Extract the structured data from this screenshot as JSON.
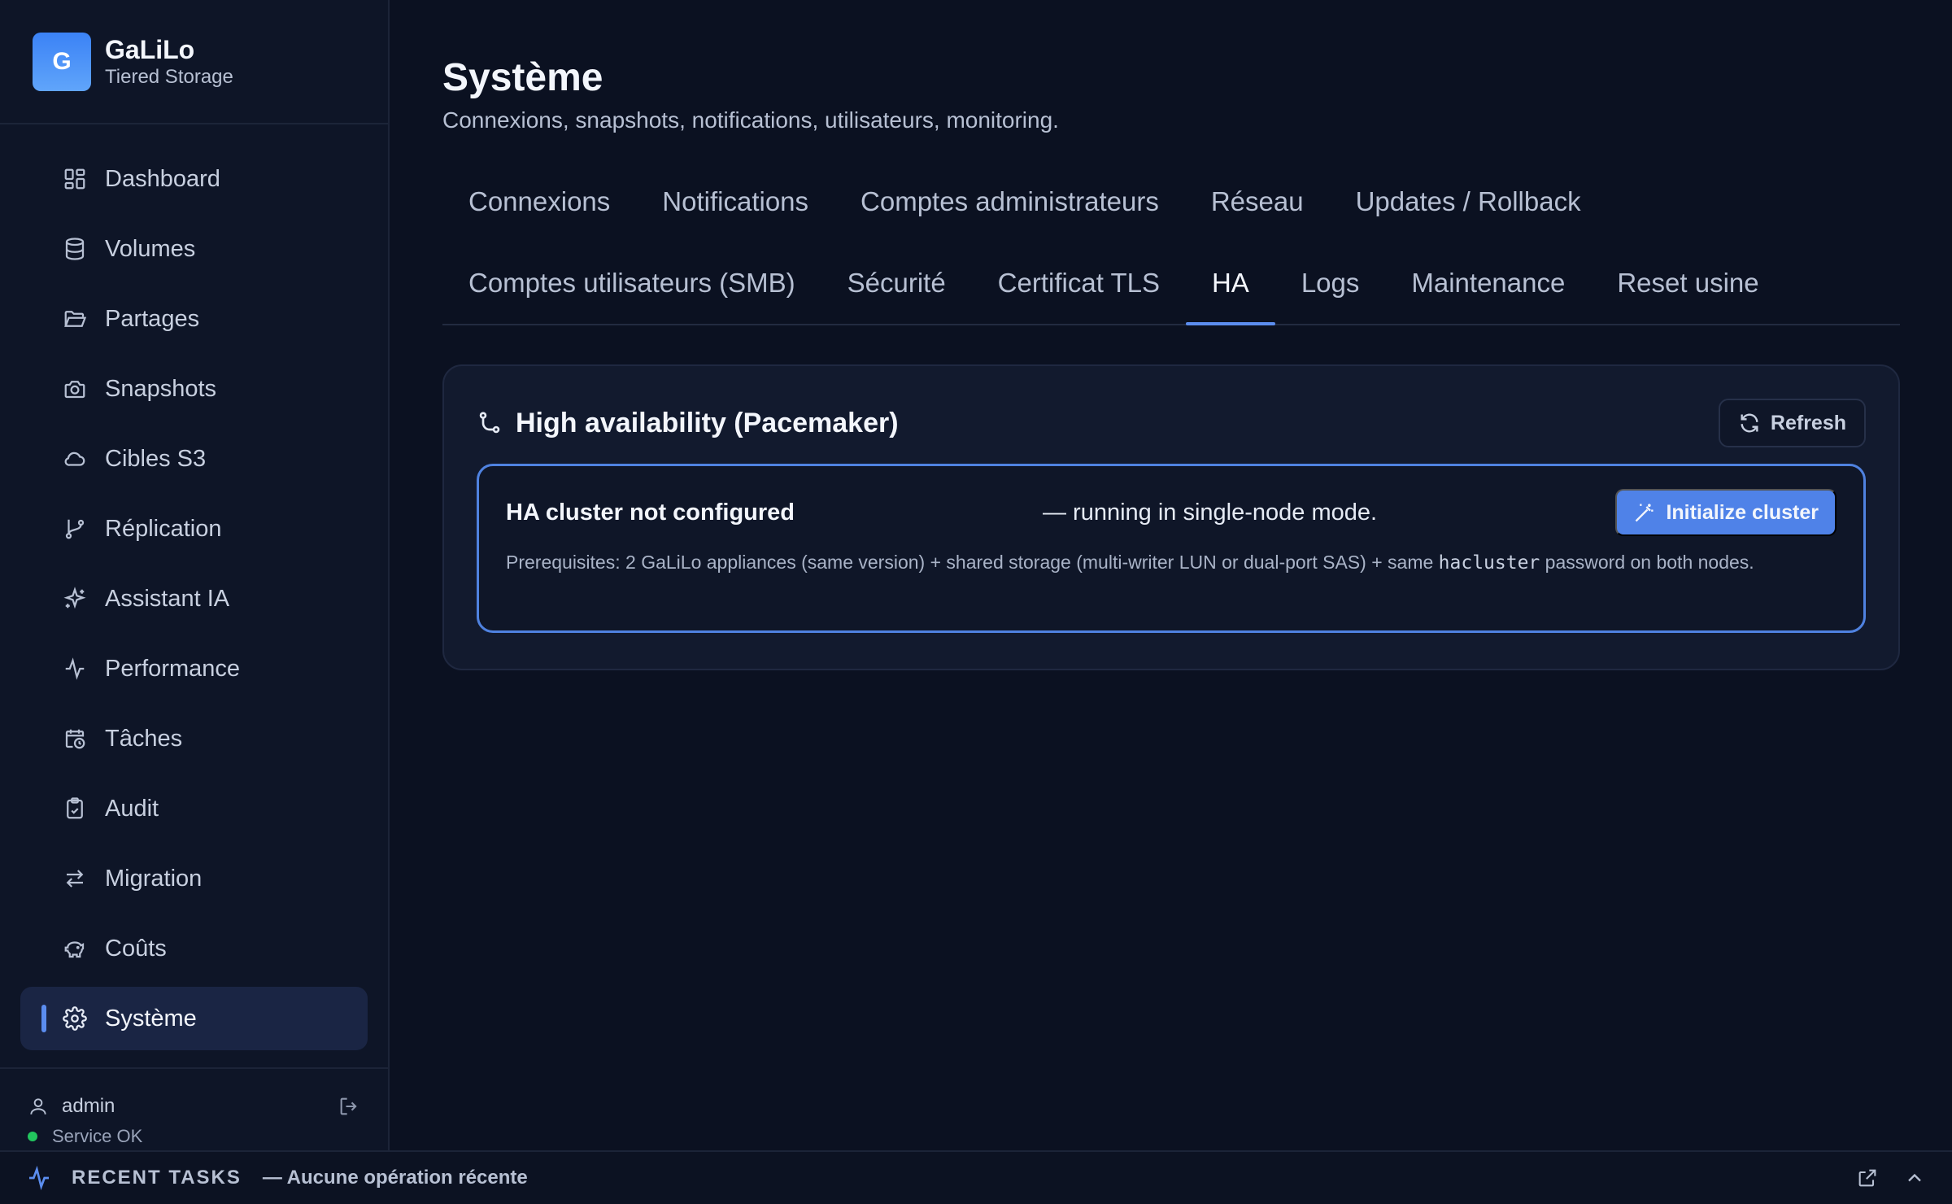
{
  "brand": {
    "logo_letter": "G",
    "name": "GaLiLo",
    "subtitle": "Tiered Storage"
  },
  "sidebar": {
    "items": [
      {
        "label": "Dashboard",
        "icon": "dashboard-icon"
      },
      {
        "label": "Volumes",
        "icon": "database-icon"
      },
      {
        "label": "Partages",
        "icon": "folder-open-icon"
      },
      {
        "label": "Snapshots",
        "icon": "camera-icon"
      },
      {
        "label": "Cibles S3",
        "icon": "cloud-icon"
      },
      {
        "label": "Réplication",
        "icon": "git-branch-icon"
      },
      {
        "label": "Assistant IA",
        "icon": "sparkles-icon"
      },
      {
        "label": "Performance",
        "icon": "activity-icon"
      },
      {
        "label": "Tâches",
        "icon": "calendar-clock-icon"
      },
      {
        "label": "Audit",
        "icon": "clipboard-check-icon"
      },
      {
        "label": "Migration",
        "icon": "arrows-swap-icon"
      },
      {
        "label": "Coûts",
        "icon": "piggy-bank-icon"
      },
      {
        "label": "Système",
        "icon": "gear-icon",
        "active": true
      }
    ],
    "user": "admin",
    "service_status": "Service OK"
  },
  "page": {
    "title": "Système",
    "subtitle": "Connexions, snapshots, notifications, utilisateurs, monitoring."
  },
  "tabs": {
    "row1": [
      "Connexions",
      "Notifications",
      "Comptes administrateurs",
      "Réseau",
      "Updates / Rollback"
    ],
    "row2": [
      "Comptes utilisateurs (SMB)",
      "Sécurité",
      "Certificat TLS",
      "HA",
      "Logs",
      "Maintenance",
      "Reset usine"
    ],
    "active": "HA"
  },
  "ha_card": {
    "title": "High availability (Pacemaker)",
    "refresh_label": "Refresh",
    "status_title": "HA cluster not configured",
    "status_mode": "— running in single-node mode.",
    "init_label": "Initialize cluster",
    "prereq_before": "Prerequisites: 2 GaLiLo appliances (same version) + shared storage (multi-writer LUN or dual-port SAS) + same ",
    "prereq_code": "hacluster",
    "prereq_after": " password on both nodes."
  },
  "bottom_bar": {
    "label": "RECENT TASKS",
    "status": "— Aucune opération récente"
  },
  "colors": {
    "accent": "#5b8def",
    "button": "#4f82e8",
    "ok": "#22c55e",
    "background": "#0b1121"
  }
}
